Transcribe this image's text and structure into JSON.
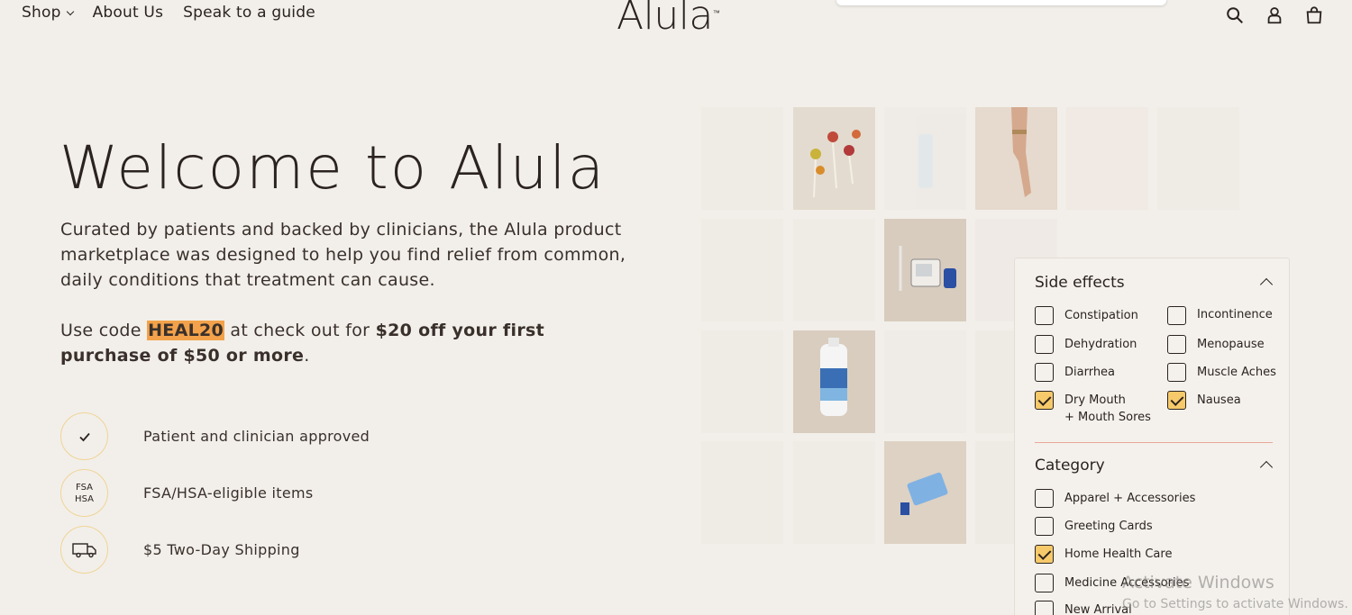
{
  "nav": {
    "shop": "Shop",
    "about": "About Us",
    "guide": "Speak to a guide"
  },
  "logo": {
    "text": "Alula",
    "tm": "™"
  },
  "hero": {
    "title": "Welcome to Alula",
    "description": "Curated by patients and backed by clinicians, the Alula product marketplace was designed to help you find relief from common, daily conditions that treatment can cause.",
    "promo_prefix": "Use code ",
    "promo_code": "HEAL20",
    "promo_middle": " at check out for ",
    "promo_bold": "$20 off your first purchase of $50 or more",
    "promo_suffix": "."
  },
  "features": [
    {
      "icon": "check-icon",
      "text": "Patient and clinician approved"
    },
    {
      "icon": "fsa-hsa-icon",
      "badge_line1": "FSA",
      "badge_line2": "HSA",
      "text": "FSA/HSA-eligible items"
    },
    {
      "icon": "truck-icon",
      "text": "$5 Two-Day Shipping"
    }
  ],
  "filters": {
    "side_effects": {
      "title": "Side effects",
      "options": [
        {
          "label": "Constipation",
          "checked": false
        },
        {
          "label": "Incontinence",
          "checked": false
        },
        {
          "label": "Dehydration",
          "checked": false
        },
        {
          "label": "Menopause",
          "checked": false
        },
        {
          "label": "Diarrhea",
          "checked": false
        },
        {
          "label": "Muscle Aches",
          "checked": false
        },
        {
          "label": "Dry Mouth\n+ Mouth Sores",
          "checked": true
        },
        {
          "label": "Nausea",
          "checked": true
        }
      ]
    },
    "category": {
      "title": "Category",
      "options": [
        {
          "label": "Apparel + Accessories",
          "checked": false
        },
        {
          "label": "Greeting Cards",
          "checked": false
        },
        {
          "label": "Home Health Care",
          "checked": true
        },
        {
          "label": "Medicine Accessories",
          "checked": false
        },
        {
          "label": "New Arrival",
          "checked": false
        }
      ]
    }
  },
  "watermark": {
    "line1": "Activate Windows",
    "line2": "Go to Settings to activate Windows."
  },
  "colors": {
    "accent": "#f6c96a",
    "code_highlight": "#f3a24b",
    "divider": "#e8a79a"
  }
}
